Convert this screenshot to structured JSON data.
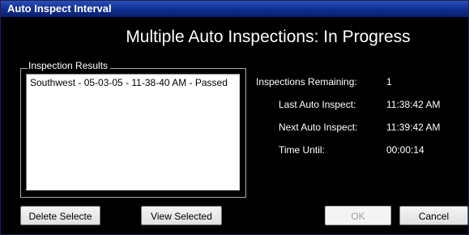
{
  "window": {
    "title": "Auto Inspect Interval"
  },
  "heading": "Multiple Auto Inspections: In Progress",
  "results": {
    "group_label": "Inspection Results",
    "items": [
      "Southwest - 05-03-05 - 11-38-40 AM - Passed"
    ]
  },
  "info": {
    "remaining_label": "Inspections Remaining:",
    "remaining_value": "1",
    "last_label": "Last Auto Inspect:",
    "last_value": "11:38:42 AM",
    "next_label": "Next Auto Inspect:",
    "next_value": "11:39:42 AM",
    "until_label": "Time Until:",
    "until_value": "00:00:14"
  },
  "buttons": {
    "delete_label": "Delete Selecte",
    "view_label": "View Selected",
    "ok_label": "OK",
    "ok_enabled": false,
    "cancel_label": "Cancel"
  },
  "colors": {
    "background": "#000000",
    "titlebar": "#0e2c8f",
    "text": "#ffffff"
  }
}
